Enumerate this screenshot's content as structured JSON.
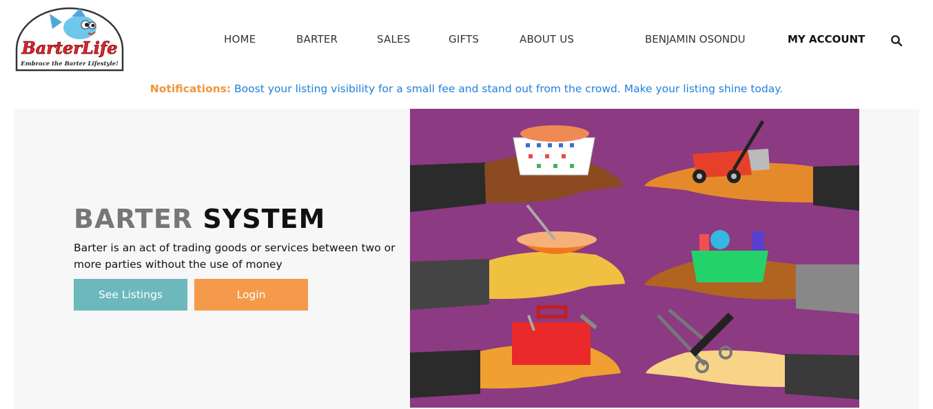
{
  "brand": {
    "logo_text": "BarterLife",
    "logo_tagline": "Embrace the Barter Lifestyle!"
  },
  "nav": {
    "items": [
      {
        "label": "HOME"
      },
      {
        "label": "BARTER"
      },
      {
        "label": "SALES"
      },
      {
        "label": "GIFTS"
      },
      {
        "label": "ABOUT US"
      }
    ],
    "user_name": "BENJAMIN OSONDU",
    "account_label": "MY ACCOUNT",
    "search_icon": "search-icon"
  },
  "notification": {
    "label": "Notifications:",
    "text": "Boost your listing visibility for a small fee and stand out from the crowd. Make your listing shine today."
  },
  "hero": {
    "title_part1": "BARTER",
    "title_part2": "SYSTEM",
    "description": "Barter is an act of trading goods or services between two or more parties without the use of money",
    "see_listings_label": "See Listings",
    "login_label": "Login",
    "image": "hands-trading-items-illustration"
  },
  "colors": {
    "accent_orange": "#f0963a",
    "link_blue": "#1f7fdc",
    "button_teal": "#6cb8bd",
    "button_orange": "#f49a4a",
    "illustration_bg": "#8c3a82"
  }
}
